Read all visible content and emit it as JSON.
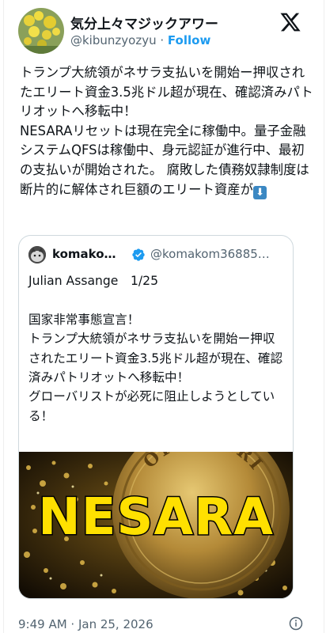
{
  "author": {
    "display_name": "気分上々マジックアワー",
    "handle": "@kibunzyozyu",
    "separator": "·",
    "follow_label": "Follow"
  },
  "tweet": {
    "text": "トランプ大統領がネサラ支払いを開始ー押収されたエリート資金3.5兆ドル超が現在、確認済みパトリオットへ移転中！\nNESARAリセットは現在完全に稼働中。量子金融システムQFSは稼働中、身元認証が進行中、最初の支払いが開始された。 腐敗した債務奴隷制度は断片的に解体され巨額のエリート資産が",
    "emoji": "down-arrow-emoji"
  },
  "quoted": {
    "display_name": "komako…",
    "handle": "@komakom36885…",
    "text": "Julian Assange　1/25\n\n国家非常事態宣言！\nトランプ大統領がネサラ支払いを開始ー押収されたエリート資金3.5兆ドル超が現在、確認済みパトリオットへ移転中！\nグローバリストが必死に阻止しようとしている！",
    "media_text": "NESARA",
    "coin_text": "OF AMERI"
  },
  "footer": {
    "timestamp": "9:49 AM · Jan 25, 2026"
  },
  "colors": {
    "accent": "#1d9bf0",
    "text": "#0f1419",
    "secondary": "#536471",
    "nesara_yellow": "#ffe000"
  }
}
